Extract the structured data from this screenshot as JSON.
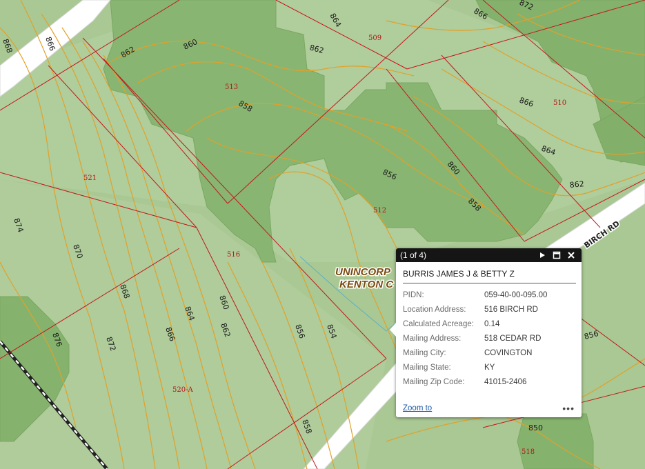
{
  "map": {
    "contour_labels": [
      "864",
      "866",
      "868",
      "866",
      "872",
      "862",
      "860",
      "862",
      "858",
      "866",
      "864",
      "856",
      "860",
      "858",
      "862",
      "874",
      "870",
      "868",
      "866",
      "864",
      "862",
      "860",
      "856",
      "854",
      "876",
      "872",
      "858",
      "850",
      "856"
    ],
    "parcel_labels": [
      "509",
      "513",
      "510",
      "521",
      "512",
      "516",
      "520-A",
      "518"
    ],
    "road_label": "BIRCH RD",
    "area_label_line1": "UNINCORP",
    "area_label_line2": "KENTON C",
    "colors": {
      "background": "#a6c690",
      "woods": "#83b26c",
      "contour": "#e1a12a",
      "parcel": "#c4161c",
      "road": "#ffffff"
    }
  },
  "popup": {
    "counter": "(1 of 4)",
    "next_icon": "play-next-icon",
    "maximize_icon": "maximize-icon",
    "close_icon": "close-icon",
    "title": "BURRIS JAMES J & BETTY Z",
    "fields": [
      {
        "label": "PIDN:",
        "value": "059-40-00-095.00"
      },
      {
        "label": "Location Address:",
        "value": "516 BIRCH RD"
      },
      {
        "label": "Calculated Acreage:",
        "value": "0.14"
      },
      {
        "label": "Mailing Address:",
        "value": "518 CEDAR RD"
      },
      {
        "label": "Mailing City:",
        "value": "COVINGTON"
      },
      {
        "label": "Mailing State:",
        "value": "KY"
      },
      {
        "label": "Mailing Zip Code:",
        "value": "41015-2406"
      }
    ],
    "zoom_label": "Zoom to",
    "more_label": "•••"
  }
}
